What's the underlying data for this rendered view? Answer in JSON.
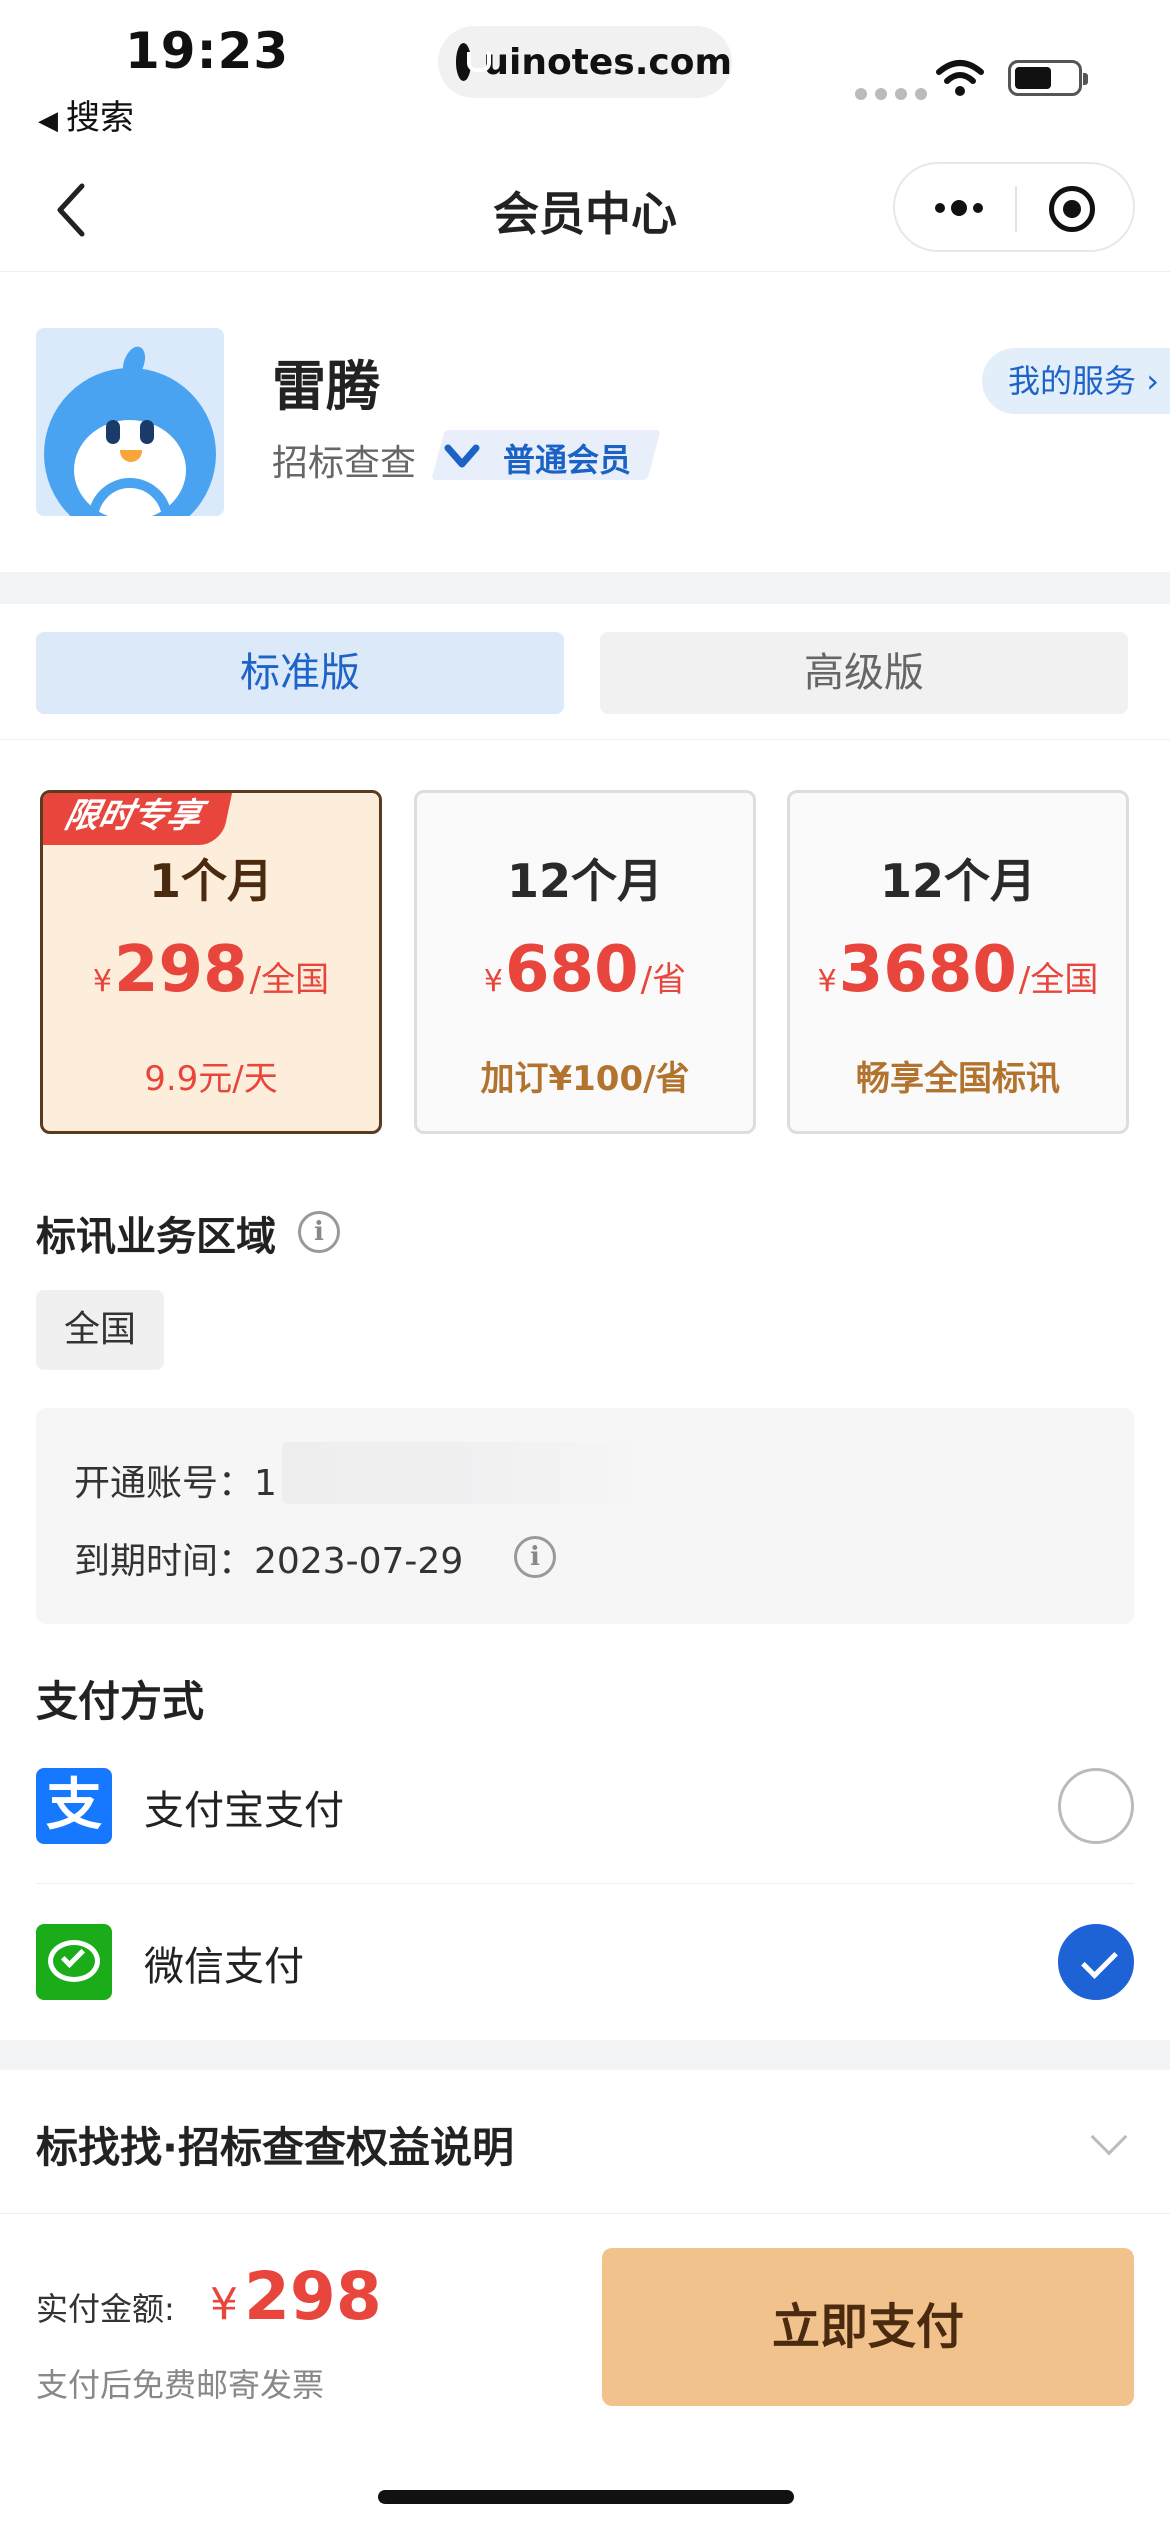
{
  "status_bar": {
    "time": "19:23",
    "back_app": "搜索",
    "url": "uinotes.com"
  },
  "nav": {
    "title": "会员中心"
  },
  "profile": {
    "username": "雷腾",
    "app_name": "招标查查",
    "member_level": "普通会员",
    "my_service": "我的服务"
  },
  "tabs": [
    {
      "label": "标准版",
      "selected": true
    },
    {
      "label": "高级版",
      "selected": false
    }
  ],
  "plans": [
    {
      "ribbon": "限时专享",
      "period": "1个月",
      "currency": "¥",
      "price": "298",
      "unit": "/全国",
      "note": "9.9元/天",
      "selected": true
    },
    {
      "period": "12个月",
      "currency": "¥",
      "price": "680",
      "unit": "/省",
      "note": "加订¥100/省",
      "selected": false
    },
    {
      "period": "12个月",
      "currency": "¥",
      "price": "3680",
      "unit": "/全国",
      "note": "畅享全国标讯",
      "selected": false
    }
  ],
  "region": {
    "title": "标讯业务区域",
    "selected": "全国"
  },
  "account": {
    "account_label": "开通账号：",
    "account_value": "1",
    "expire_label": "到期时间：",
    "expire_value": "2023-07-29"
  },
  "payment": {
    "title": "支付方式",
    "methods": [
      {
        "label": "支付宝支付",
        "icon": "alipay-icon",
        "selected": false
      },
      {
        "label": "微信支付",
        "icon": "wechat-pay-icon",
        "selected": true
      }
    ]
  },
  "rights": {
    "title": "标找找·招标查查权益说明"
  },
  "footer": {
    "amount_label": "实付金额:",
    "currency": "¥",
    "amount": "298",
    "invoice_note": "支付后免费邮寄发票",
    "pay_button": "立即支付"
  },
  "colors": {
    "accent_blue": "#1e63c7",
    "price_red": "#e8453c",
    "pay_button": "#f2c28c"
  }
}
